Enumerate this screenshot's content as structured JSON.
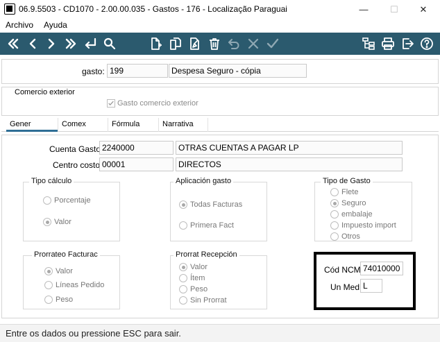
{
  "window": {
    "title": "06.9.5503 - CD1070 - 2.00.00.035 - Gastos - 176 - Localização Paraguai",
    "minimize": "—",
    "maximize": "☐",
    "close": "✕"
  },
  "menu": {
    "items": [
      "Archivo",
      "Ayuda"
    ]
  },
  "toolbar": {
    "left_icons": [
      "first-record-icon",
      "previous-record-icon",
      "next-record-icon",
      "last-record-icon",
      "return-icon",
      "search-icon"
    ],
    "middle_icons": [
      "new-document-icon",
      "copy-document-icon",
      "edit-document-icon",
      "delete-icon",
      "undo-icon",
      "cancel-icon",
      "confirm-icon"
    ],
    "right_icons": [
      "structure-icon",
      "print-icon",
      "exit-icon",
      "help-icon"
    ]
  },
  "header": {
    "gasto_label": "gasto:",
    "gasto_code": "199",
    "gasto_desc": "Despesa Seguro - cópia"
  },
  "comercio": {
    "title": "Comercio exterior",
    "checkbox_label": "Gasto comercio exterior",
    "checked": true
  },
  "tabs": [
    "Gener",
    "Comex",
    "Fórmula",
    "Narrativa"
  ],
  "general": {
    "cuenta_label": "Cuenta Gasto:",
    "cuenta_code": "2240000",
    "cuenta_desc": "OTRAS CUENTAS A PAGAR LP",
    "centro_label": "Centro costo:",
    "centro_code": "00001",
    "centro_desc": "DIRECTOS",
    "tipo_calculo": {
      "title": "Tipo cálculo",
      "options": [
        "Porcentaje",
        "Valor"
      ],
      "selected": "Valor"
    },
    "aplicacion": {
      "title": "Aplicación gasto",
      "options": [
        "Todas Facturas",
        "Primera Fact"
      ],
      "selected": "Todas Facturas"
    },
    "tipo_gasto": {
      "title": "Tipo de Gasto",
      "options": [
        "Flete",
        "Seguro",
        "embalaje",
        "Impuesto import",
        "Otros"
      ],
      "selected": "Seguro"
    },
    "prorrateo": {
      "title": "Prorrateo Facturac",
      "options": [
        "Valor",
        "Líneas Pedido",
        "Peso"
      ],
      "selected": "Valor"
    },
    "prorrat_recepcion": {
      "title": "Prorrat Recepción",
      "options": [
        "Valor",
        "Ítem",
        "Peso",
        "Sin Prorrat"
      ],
      "selected": "Valor"
    },
    "ncm_label": "Cód NCM:",
    "ncm_value": "74010000",
    "unmed_label": "Un Med:",
    "unmed_value": "L"
  },
  "status": {
    "text": "Entre os dados ou pressione ESC para sair."
  },
  "colors": {
    "toolbar": "#2b5a6e",
    "tab_accent": "#2f6e95",
    "highlight_border": "#000000"
  }
}
